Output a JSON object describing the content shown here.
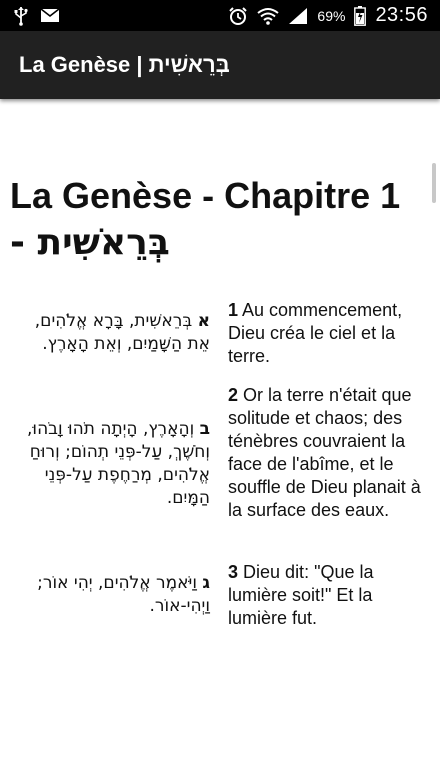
{
  "status_bar": {
    "icons_left": [
      "usb-icon",
      "mail-icon"
    ],
    "icons_right": [
      "alarm-icon",
      "wifi-icon",
      "signal-icon",
      "battery-icon"
    ],
    "battery": "69%",
    "time": "23:56"
  },
  "app_bar": {
    "title": "La Genèse | בְּרֵאשִׁית"
  },
  "content": {
    "chapter_title_fr": "La Genèse - Chapitre 1",
    "chapter_title_he": "- בְּרֵאשִׁית",
    "verses": [
      {
        "he_num": "א",
        "he_text": "בְּרֵאשִׁית, בָּרָא אֱלֹהִים, אֵת הַשָּׁמַיִם, וְאֵת הָאָרֶץ.",
        "fr_num": "1",
        "fr_text": "Au commencement, Dieu créa le ciel et la terre."
      },
      {
        "he_num": "ב",
        "he_text": "וְהָאָרֶץ, הָיְתָה תֹהוּ וָבֹהוּ, וְחֹשֶׁךְ, עַל-פְּנֵי תְהוֹם; וְרוּחַ אֱלֹהִים, מְרַחֶפֶת עַל-פְּנֵי הַמָּיִם.",
        "fr_num": "2",
        "fr_text": "Or la terre n'était que solitude et chaos; des ténèbres couvraient la face de l'abîme, et le souffle de Dieu planait à la surface des eaux."
      },
      {
        "he_num": "ג",
        "he_text": "וַיֹּאמֶר אֱלֹהִים, יְהִי אוֹר; וַיְהִי-אוֹר.",
        "fr_num": "3",
        "fr_text": "Dieu dit: \"Que la lumière soit!\" Et la lumière fut."
      }
    ]
  }
}
